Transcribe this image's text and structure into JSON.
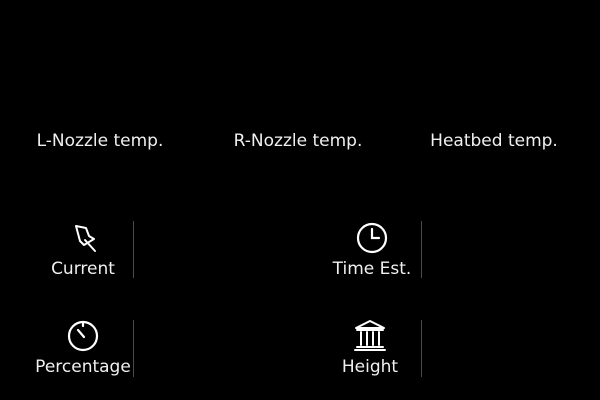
{
  "temperatures": {
    "left_nozzle_label": "L-Nozzle temp.",
    "right_nozzle_label": "R-Nozzle temp.",
    "heatbed_label": "Heatbed temp."
  },
  "stats": {
    "current": {
      "label": "Current",
      "icon": "pin-icon"
    },
    "percentage": {
      "label": "Percentage",
      "icon": "gauge-icon"
    },
    "time_est": {
      "label": "Time Est.",
      "icon": "clock-icon"
    },
    "height": {
      "label": "Height",
      "icon": "pillar-building-icon"
    }
  },
  "colors": {
    "background": "#000000",
    "text": "#f0f0f0",
    "divider": "#4a4a4a"
  }
}
